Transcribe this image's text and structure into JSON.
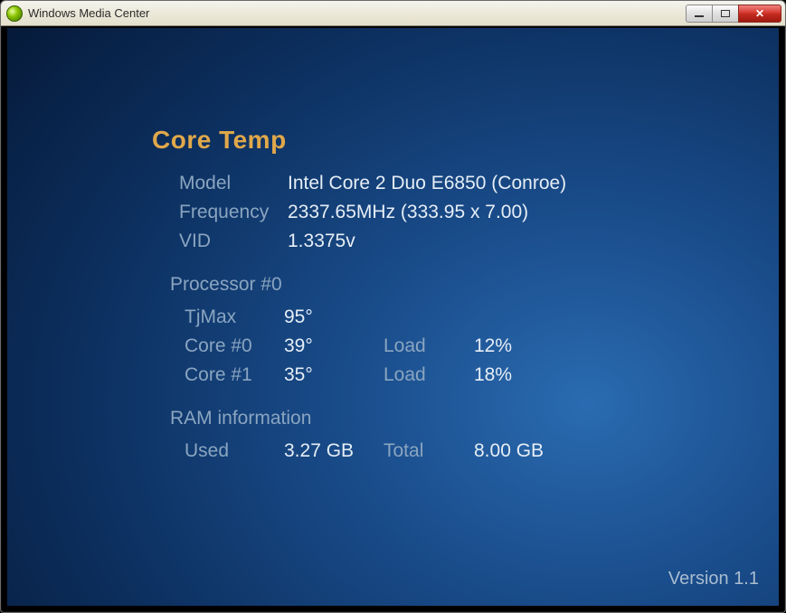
{
  "window": {
    "title": "Windows Media Center"
  },
  "app": {
    "title": "Core Temp",
    "labels": {
      "model": "Model",
      "frequency": "Frequency",
      "vid": "VID"
    },
    "values": {
      "model": "Intel Core 2 Duo E6850 (Conroe)",
      "frequency": "2337.65MHz (333.95 x 7.00)",
      "vid": "1.3375v"
    },
    "processor_heading": "Processor #0",
    "tjmax_label": "TjMax",
    "tjmax_value": "95°",
    "load_label": "Load",
    "cores": [
      {
        "name": "Core #0",
        "temp": "39°",
        "load": "12%"
      },
      {
        "name": "Core #1",
        "temp": "35°",
        "load": "18%"
      }
    ],
    "ram_heading": "RAM information",
    "ram": {
      "used_label": "Used",
      "used_value": "3.27 GB",
      "total_label": "Total",
      "total_value": "8.00 GB"
    },
    "version": "Version 1.1"
  }
}
